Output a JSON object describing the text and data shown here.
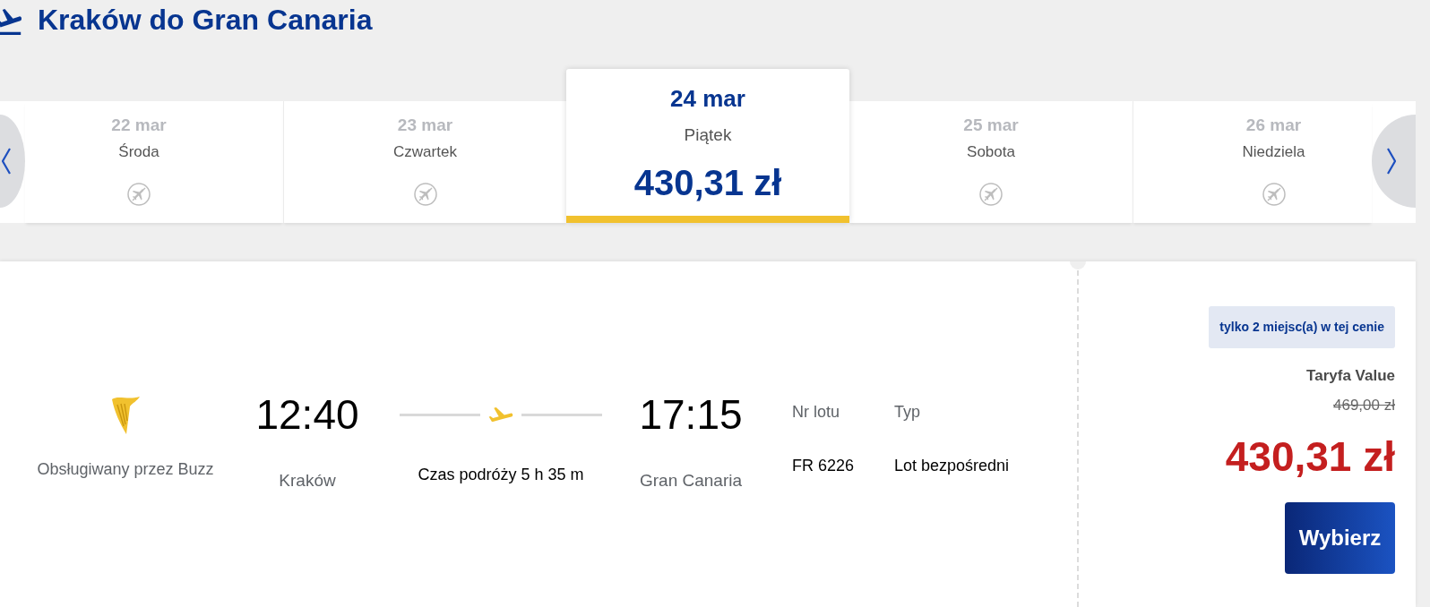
{
  "header": {
    "title": "Kraków do Gran Canaria"
  },
  "date_strip": {
    "days": [
      {
        "date": "22 mar",
        "weekday": "Środa",
        "kind": "no_flight",
        "selected": false
      },
      {
        "date": "23 mar",
        "weekday": "Czwartek",
        "kind": "no_flight",
        "selected": false
      },
      {
        "date": "24 mar",
        "weekday": "Piątek",
        "kind": "fare",
        "price": "430,31 zł",
        "selected": true
      },
      {
        "date": "25 mar",
        "weekday": "Sobota",
        "kind": "no_flight",
        "selected": false
      },
      {
        "date": "26 mar",
        "weekday": "Niedziela",
        "kind": "no_flight",
        "selected": false
      }
    ]
  },
  "flight": {
    "operator": "Obsługiwany przez Buzz",
    "departure": {
      "time": "12:40",
      "airport": "Kraków"
    },
    "duration": "Czas podróży 5 h 35 m",
    "arrival": {
      "time": "17:15",
      "airport": "Gran Canaria"
    },
    "details": [
      {
        "label": "Nr lotu",
        "value": "FR 6226"
      },
      {
        "label": "Typ",
        "value": "Lot bezpośredni"
      }
    ]
  },
  "fare": {
    "badge": "tylko 2 miejsc(a) w tej cenie",
    "name": "Taryfa Value",
    "old_price": "469,00 zł",
    "price": "430,31 zł",
    "button": "Wybierz"
  }
}
